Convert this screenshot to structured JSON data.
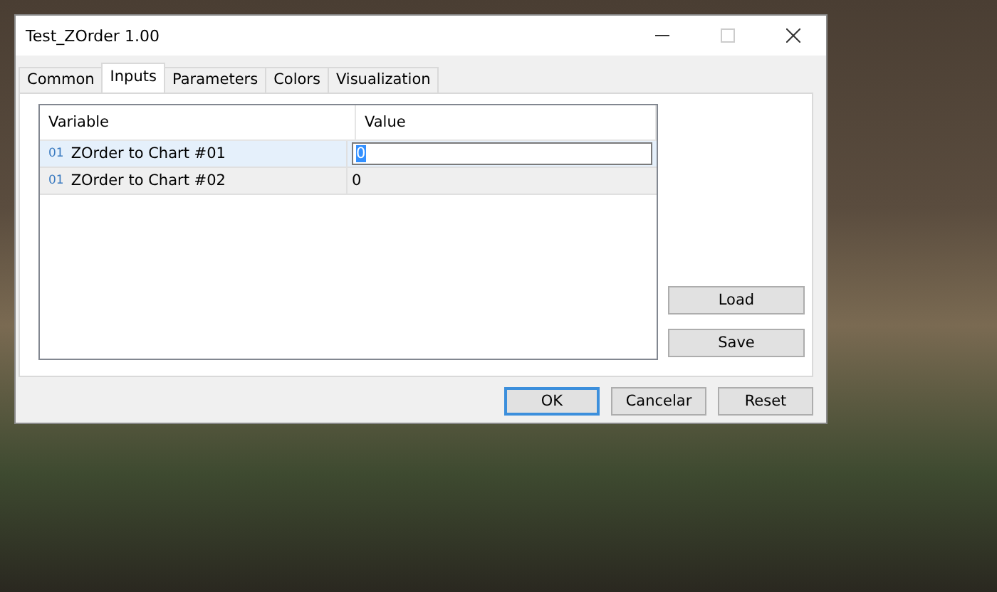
{
  "window": {
    "title": "Test_ZOrder 1.00"
  },
  "tabs": [
    {
      "label": "Common",
      "selected": false
    },
    {
      "label": "Inputs",
      "selected": true
    },
    {
      "label": "Parameters",
      "selected": false
    },
    {
      "label": "Colors",
      "selected": false
    },
    {
      "label": "Visualization",
      "selected": false
    }
  ],
  "table": {
    "columns": [
      "Variable",
      "Value"
    ],
    "rows": [
      {
        "type_tag": "01",
        "variable": "ZOrder to Chart #01",
        "value": "0",
        "selected": true,
        "editing": true
      },
      {
        "type_tag": "01",
        "variable": "ZOrder to Chart #02",
        "value": "0",
        "selected": false,
        "editing": false
      }
    ]
  },
  "side_buttons": [
    "Load",
    "Save"
  ],
  "buttons": [
    {
      "label": "OK",
      "default": true
    },
    {
      "label": "Cancelar",
      "default": false
    },
    {
      "label": "Reset",
      "default": false
    }
  ]
}
